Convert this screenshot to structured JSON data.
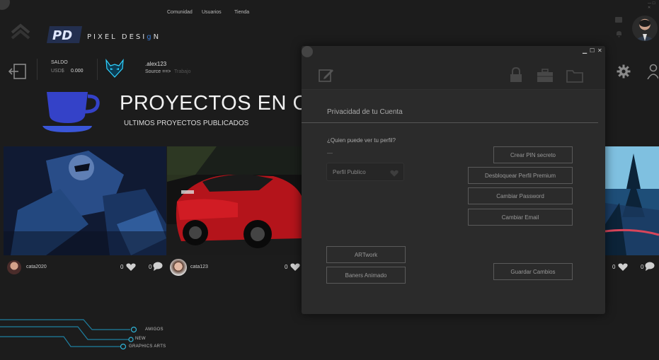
{
  "nav": {
    "comunidad": "Comunidad",
    "usuarios": "Usuarios",
    "tienda": "Tienda"
  },
  "brand": {
    "logo_letters": "PD",
    "name_part1": "PIXEL DESI",
    "name_accent": "g",
    "name_part2": "N"
  },
  "account": {
    "saldo_label": "SALDO",
    "currency": "USD$",
    "balance": "0.000",
    "username": ".alex123",
    "source_label": "Source ==>",
    "source_value": "Trabajo"
  },
  "hero": {
    "title": "PROYECTOS EN CE",
    "subtitle": "ULTIMOS PROYECTOS PUBLICADOS"
  },
  "cards": [
    {
      "user": "cata2020",
      "likes": "0",
      "comments": "0"
    },
    {
      "user": "cata123",
      "likes": "0",
      "comments": ""
    },
    {
      "user": "",
      "likes": "0",
      "comments": "0"
    }
  ],
  "modal": {
    "section_title": "Privacidad de tu Cuenta",
    "question": "¿Quien puede ver tu perfil?",
    "dash": "—",
    "profile_select": "Perfil Publico",
    "btn_pin": "Crear PIN secreto",
    "btn_premium": "Desbloquear Perfil Premium",
    "btn_password": "Cambiar Password",
    "btn_email": "Cambiar Email",
    "btn_artwork": "ARTwork",
    "btn_banners": "Baners Animado",
    "btn_save": "Guardar Cambios",
    "ctrl_min": "▁",
    "ctrl_max": "☐",
    "ctrl_close": "✕"
  },
  "footer": {
    "amigos": "AMIGOS",
    "new": "NEW",
    "graphics": "GRAPHICS ARTS"
  },
  "colors": {
    "accent": "#2fb3d6",
    "brand_blue": "#3a5bd0",
    "bg": "#1c1c1c",
    "modal_bg": "#2b2b2b"
  }
}
